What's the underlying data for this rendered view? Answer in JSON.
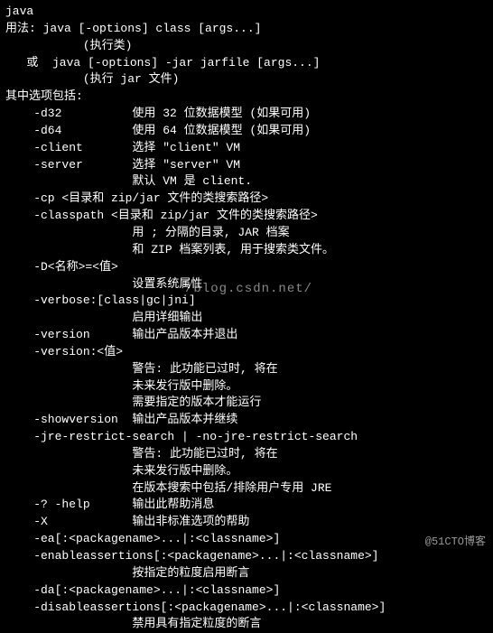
{
  "lines": [
    "java",
    "用法: java [-options] class [args...]",
    "           (执行类)",
    "   或  java [-options] -jar jarfile [args...]",
    "           (执行 jar 文件)",
    "",
    "其中选项包括:",
    "    -d32          使用 32 位数据模型 (如果可用)",
    "    -d64          使用 64 位数据模型 (如果可用)",
    "    -client       选择 \"client\" VM",
    "    -server       选择 \"server\" VM",
    "                  默认 VM 是 client.",
    "",
    "    -cp <目录和 zip/jar 文件的类搜索路径>",
    "    -classpath <目录和 zip/jar 文件的类搜索路径>",
    "                  用 ; 分隔的目录, JAR 档案",
    "                  和 ZIP 档案列表, 用于搜索类文件。",
    "    -D<名称>=<值>",
    "                  设置系统属性",
    "    -verbose:[class|gc|jni]",
    "                  启用详细输出",
    "    -version      输出产品版本并退出",
    "    -version:<值>",
    "                  警告: 此功能已过时, 将在",
    "                  未来发行版中删除。",
    "                  需要指定的版本才能运行",
    "    -showversion  输出产品版本并继续",
    "    -jre-restrict-search | -no-jre-restrict-search",
    "                  警告: 此功能已过时, 将在",
    "                  未来发行版中删除。",
    "                  在版本搜索中包括/排除用户专用 JRE",
    "    -? -help      输出此帮助消息",
    "    -X            输出非标准选项的帮助",
    "    -ea[:<packagename>...|:<classname>]",
    "    -enableassertions[:<packagename>...|:<classname>]",
    "                  按指定的粒度启用断言",
    "    -da[:<packagename>...|:<classname>]",
    "    -disableassertions[:<packagename>...|:<classname>]",
    "                  禁用具有指定粒度的断言"
  ],
  "watermark": "/blog.csdn.net/",
  "footer": "@51CTO博客"
}
